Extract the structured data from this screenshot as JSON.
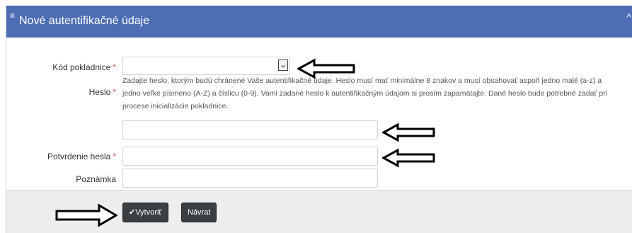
{
  "header": {
    "title": "Nové autentifikačné údaje",
    "menu_icon": "≡",
    "collapse_icon": "^"
  },
  "form": {
    "cash_register": {
      "label": "Kód pokladnice",
      "required_mark": "*",
      "value": ""
    },
    "password": {
      "label": "Heslo",
      "required_mark": "*",
      "help": "Zadajte heslo, ktorým budú chránené Vaše autentifikačné údaje. Heslo musí mať minimálne 8 znakov a musí obsahovať aspoň jedno malé (a-z) a jedno veľké písmeno (A-Z) a číslicu (0-9). Vami zadané heslo k autentifikačným údajom si prosím zapamätajte. Dané heslo bude potrebné zadať pri procese inicializácie pokladnice.",
      "value": ""
    },
    "password_confirm": {
      "label": "Potvrdenie hesla",
      "required_mark": "*",
      "value": ""
    },
    "note": {
      "label": "Poznámka",
      "value": ""
    }
  },
  "buttons": {
    "create": "Vytvoriť",
    "create_icon": "✔",
    "back": "Návrat"
  }
}
